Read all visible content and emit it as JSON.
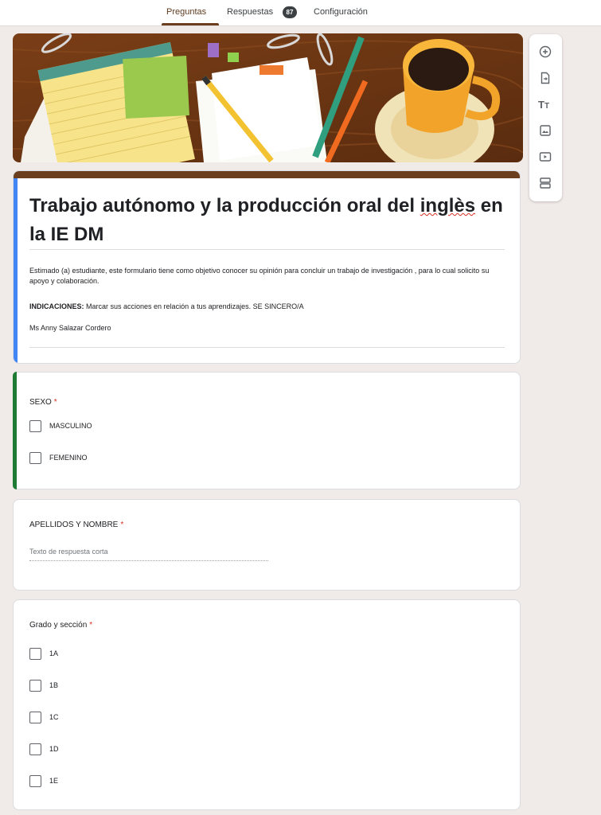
{
  "tabs": {
    "preguntas": "Preguntas",
    "respuestas": "Respuestas",
    "respuestas_badge": "87",
    "configuracion": "Configuración"
  },
  "toolbar": {
    "items": [
      "add-question-icon",
      "import-questions-icon",
      "add-title-icon",
      "add-image-icon",
      "add-video-icon",
      "add-section-icon"
    ]
  },
  "form": {
    "title_part1": "Trabajo autónomo y la producción oral del ",
    "title_spell": "inglès",
    "title_part2": " en la IE DM",
    "description_1": "Estimado (a) estudiante, este formulario tiene como objetivo conocer su opinión para concluir un trabajo de investigación , para lo cual solicito su apoyo y colaboración.",
    "indications_label": "INDICACIONES:",
    "indications_text": " Marcar sus acciones en relación a tus aprendizajes. SE SINCERO/A",
    "author": "Ms Anny Salazar Cordero"
  },
  "questions": [
    {
      "title": "SEXO",
      "required": "*",
      "options": [
        "MASCULINO",
        "FEMENINO"
      ]
    },
    {
      "title": "APELLIDOS Y NOMBRE",
      "required": "*",
      "placeholder": "Texto de respuesta corta"
    },
    {
      "title": "Grado y sección",
      "required": "*",
      "options": [
        "1A",
        "1B",
        "1C",
        "1D",
        "1E"
      ]
    }
  ],
  "colors": {
    "theme_header": "#6b3f1e",
    "active_card_bar": "#1e7b34",
    "title_card_bar": "#4285f4",
    "required": "#d93025"
  }
}
